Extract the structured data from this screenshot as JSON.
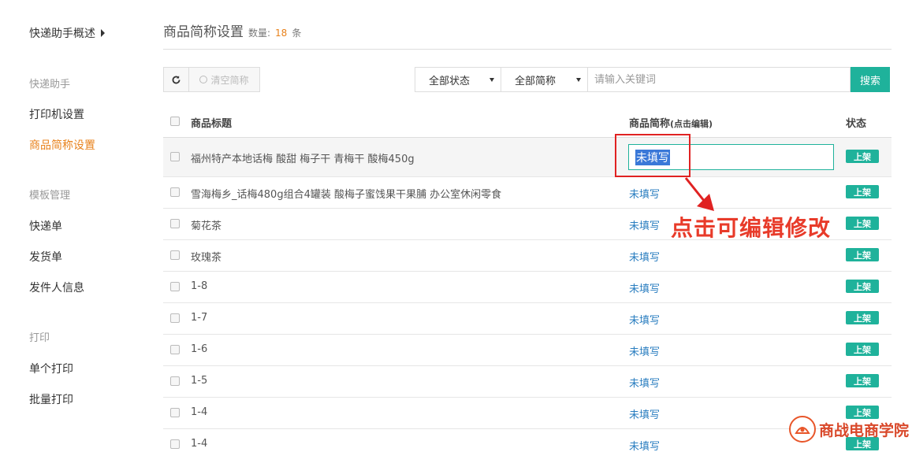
{
  "sidebar": {
    "top_link": "快递助手概述",
    "sections": [
      {
        "title": "快递助手",
        "items": [
          "打印机设置",
          "商品简称设置"
        ]
      },
      {
        "title": "模板管理",
        "items": [
          "快递单",
          "发货单",
          "发件人信息"
        ]
      },
      {
        "title": "打印",
        "items": [
          "单个打印",
          "批量打印"
        ]
      }
    ],
    "active_item": "商品简称设置"
  },
  "page": {
    "title": "商品简称设置",
    "count_label": "数量:",
    "count_value": "18",
    "count_unit": "条"
  },
  "toolbar": {
    "clear_label": "清空简称",
    "status_select": "全部状态",
    "name_select": "全部简称",
    "search_placeholder": "请输入关键词",
    "search_label": "搜索"
  },
  "table": {
    "headers": {
      "title": "商品标题",
      "short_name": "商品简称",
      "short_name_hint": "(点击编辑)",
      "status": "状态"
    },
    "rows": [
      {
        "title": "福州特产本地话梅 酸甜 梅子干 青梅干 酸梅450g",
        "short_name": "未填写",
        "status": "上架"
      },
      {
        "title": "雪海梅乡_话梅480g组合4罐装 酸梅子蜜饯果干果脯 办公室休闲零食",
        "short_name": "未填写",
        "status": "上架"
      },
      {
        "title": "菊花茶",
        "short_name": "未填写",
        "status": "上架"
      },
      {
        "title": "玫瑰茶",
        "short_name": "未填写",
        "status": "上架"
      },
      {
        "title": "1-8",
        "short_name": "未填写",
        "status": "上架"
      },
      {
        "title": "1-7",
        "short_name": "未填写",
        "status": "上架"
      },
      {
        "title": "1-6",
        "short_name": "未填写",
        "status": "上架"
      },
      {
        "title": "1-5",
        "short_name": "未填写",
        "status": "上架"
      },
      {
        "title": "1-4",
        "short_name": "未填写",
        "status": "上架"
      },
      {
        "title": "1-4",
        "short_name": "未填写",
        "status": "上架"
      }
    ]
  },
  "annotation": {
    "text": "点击可编辑修改"
  },
  "watermark": {
    "text": "商战电商学院"
  },
  "colors": {
    "accent_orange": "#e8821c",
    "brand_green": "#1fb29b",
    "link_blue": "#2a7ec0",
    "annotation_red": "#e83b2a"
  }
}
